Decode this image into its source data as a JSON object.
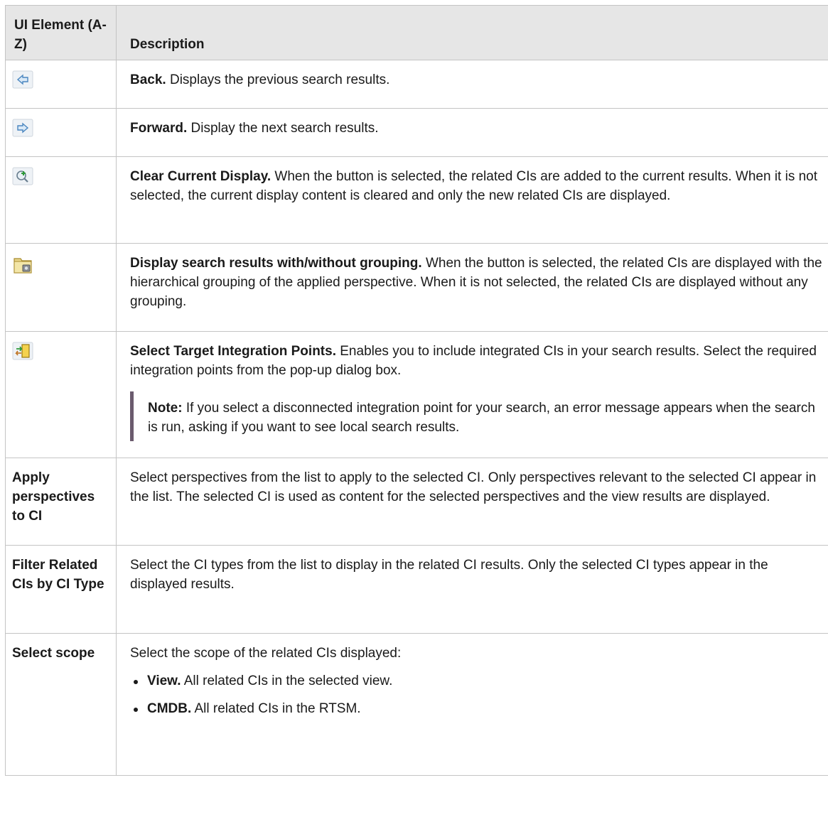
{
  "header": {
    "col1": "UI Element (A-Z)",
    "col2": "Description"
  },
  "rows": {
    "back": {
      "icon": "back-arrow-icon",
      "title": "Back.",
      "text": " Displays the previous search results."
    },
    "forward": {
      "icon": "forward-arrow-icon",
      "title": "Forward.",
      "text": " Display the next search results."
    },
    "clear": {
      "icon": "magnifier-plus-icon",
      "title": "Clear Current Display.",
      "text": " When the button is selected, the related CIs are added to the current results. When it is not selected, the current display content is cleared and only the new related CIs are displayed."
    },
    "grouping": {
      "icon": "folder-grouping-icon",
      "title": "Display search results with/without grouping.",
      "text": " When the button is selected, the related CIs are displayed with the hierarchical grouping of the applied perspective. When it is not selected, the related CIs are displayed without any grouping."
    },
    "target": {
      "icon": "integration-points-icon",
      "title": "Select Target Integration Points.",
      "text": " Enables you to include integrated CIs in your search results. Select the required integration points from the pop-up dialog box.",
      "note_label": "Note:",
      "note_text": " If you select a disconnected integration point for your search, an error message appears when the search is run, asking if you want to see local search results."
    },
    "apply": {
      "label": "Apply perspectives to CI",
      "text": "Select perspectives from the list to apply to the selected CI. Only perspectives relevant to the selected CI appear in the list. The selected CI is used as content for the selected perspectives and the view results are displayed."
    },
    "filter": {
      "label": "Filter Related CIs by CI Type",
      "text": "Select the CI types from the list to display in the related CI results. Only the selected CI types appear in the displayed results."
    },
    "scope": {
      "label": "Select scope",
      "text": "Select the scope of the related CIs displayed:",
      "items": [
        {
          "title": "View.",
          "text": " All related CIs in the selected view."
        },
        {
          "title": "CMDB.",
          "text": " All related CIs in the RTSM."
        }
      ]
    }
  },
  "colors": {
    "header_bg": "#e6e6e6",
    "border": "#c4c4c4",
    "note_bar": "#6b5b6e"
  }
}
